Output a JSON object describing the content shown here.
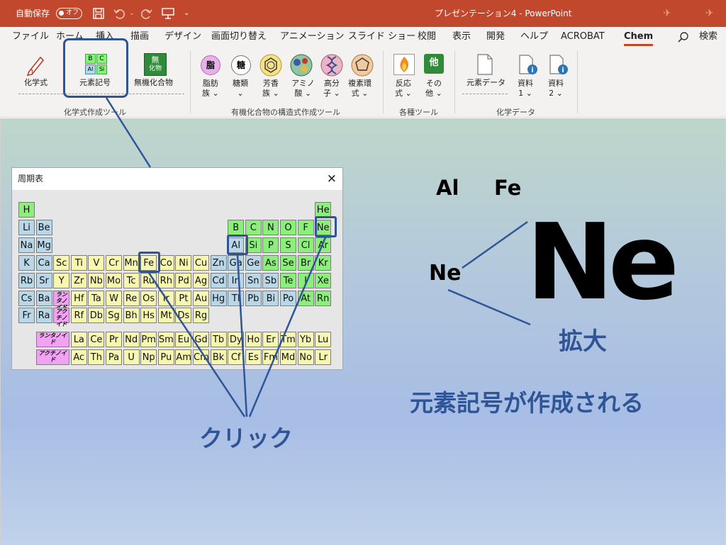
{
  "titlebar": {
    "autosave": "自動保存",
    "toggle": "オフ",
    "title": "プレゼンテーション4  -  PowerPoint"
  },
  "tabs": [
    {
      "label": "ファイル"
    },
    {
      "label": "ホーム"
    },
    {
      "label": "挿入"
    },
    {
      "label": "描画"
    },
    {
      "label": "デザイン"
    },
    {
      "label": "画面切り替え"
    },
    {
      "label": "アニメーション"
    },
    {
      "label": "スライド ショー"
    },
    {
      "label": "校閲"
    },
    {
      "label": "表示"
    },
    {
      "label": "開発"
    },
    {
      "label": "ヘルプ"
    },
    {
      "label": "ACROBAT"
    },
    {
      "label": "Chem"
    }
  ],
  "search_label": "検索",
  "ribbon": {
    "formula": "化学式",
    "element_symbol": "元素記号",
    "inorganic": "無機化合物",
    "inorganic_icon1": "無",
    "inorganic_icon2": "化物",
    "group1": "化学式作成ツール",
    "fatty1": "脂肪",
    "fatty2": "族",
    "sugar": "糖類",
    "aromatic1": "芳香",
    "aromatic2": "族",
    "amino1": "アミノ",
    "amino2": "酸",
    "polymer1": "高分",
    "polymer2": "子",
    "hetero1": "複素環",
    "hetero2": "式",
    "group2": "有機化合物の構造式作成ツール",
    "reaction1": "反応",
    "reaction2": "式",
    "other1": "その",
    "other2": "他",
    "group3": "各種ツール",
    "elemdata": "元素データ",
    "doc1a": "資料",
    "doc1b": "1",
    "doc2a": "資料",
    "doc2b": "2",
    "group4": "化学データ",
    "icon_fat": "脂",
    "icon_sugar": "糖",
    "icon_other": "他",
    "icon_elem_b": "B",
    "icon_elem_c": "C",
    "icon_elem_al": "Al",
    "icon_elem_si": "Si"
  },
  "dialog": {
    "title": "周期表",
    "close": "×"
  },
  "periodic_table": [
    {
      "s": "H",
      "c": "g",
      "r": 0,
      "col": 0
    },
    {
      "s": "He",
      "c": "g",
      "r": 0,
      "col": 17
    },
    {
      "s": "Li",
      "c": "b",
      "r": 1,
      "col": 0
    },
    {
      "s": "Be",
      "c": "b",
      "r": 1,
      "col": 1
    },
    {
      "s": "B",
      "c": "g",
      "r": 1,
      "col": 12
    },
    {
      "s": "C",
      "c": "g",
      "r": 1,
      "col": 13
    },
    {
      "s": "N",
      "c": "g",
      "r": 1,
      "col": 14
    },
    {
      "s": "O",
      "c": "g",
      "r": 1,
      "col": 15
    },
    {
      "s": "F",
      "c": "g",
      "r": 1,
      "col": 16
    },
    {
      "s": "Ne",
      "c": "g",
      "r": 1,
      "col": 17
    },
    {
      "s": "Na",
      "c": "b",
      "r": 2,
      "col": 0
    },
    {
      "s": "Mg",
      "c": "b",
      "r": 2,
      "col": 1
    },
    {
      "s": "Al",
      "c": "b",
      "r": 2,
      "col": 12
    },
    {
      "s": "Si",
      "c": "g",
      "r": 2,
      "col": 13
    },
    {
      "s": "P",
      "c": "g",
      "r": 2,
      "col": 14
    },
    {
      "s": "S",
      "c": "g",
      "r": 2,
      "col": 15
    },
    {
      "s": "Cl",
      "c": "g",
      "r": 2,
      "col": 16
    },
    {
      "s": "Ar",
      "c": "g",
      "r": 2,
      "col": 17
    },
    {
      "s": "K",
      "c": "b",
      "r": 3,
      "col": 0
    },
    {
      "s": "Ca",
      "c": "b",
      "r": 3,
      "col": 1
    },
    {
      "s": "Sc",
      "c": "y",
      "r": 3,
      "col": 2
    },
    {
      "s": "Ti",
      "c": "y",
      "r": 3,
      "col": 3
    },
    {
      "s": "V",
      "c": "y",
      "r": 3,
      "col": 4
    },
    {
      "s": "Cr",
      "c": "y",
      "r": 3,
      "col": 5
    },
    {
      "s": "Mn",
      "c": "y",
      "r": 3,
      "col": 6
    },
    {
      "s": "Fe",
      "c": "y",
      "r": 3,
      "col": 7
    },
    {
      "s": "Co",
      "c": "y",
      "r": 3,
      "col": 8
    },
    {
      "s": "Ni",
      "c": "y",
      "r": 3,
      "col": 9
    },
    {
      "s": "Cu",
      "c": "y",
      "r": 3,
      "col": 10
    },
    {
      "s": "Zn",
      "c": "b",
      "r": 3,
      "col": 11
    },
    {
      "s": "Ga",
      "c": "b",
      "r": 3,
      "col": 12
    },
    {
      "s": "Ge",
      "c": "b",
      "r": 3,
      "col": 13
    },
    {
      "s": "As",
      "c": "g",
      "r": 3,
      "col": 14
    },
    {
      "s": "Se",
      "c": "g",
      "r": 3,
      "col": 15
    },
    {
      "s": "Br",
      "c": "g",
      "r": 3,
      "col": 16
    },
    {
      "s": "Kr",
      "c": "g",
      "r": 3,
      "col": 17
    },
    {
      "s": "Rb",
      "c": "b",
      "r": 4,
      "col": 0
    },
    {
      "s": "Sr",
      "c": "b",
      "r": 4,
      "col": 1
    },
    {
      "s": "Y",
      "c": "y",
      "r": 4,
      "col": 2
    },
    {
      "s": "Zr",
      "c": "y",
      "r": 4,
      "col": 3
    },
    {
      "s": "Nb",
      "c": "y",
      "r": 4,
      "col": 4
    },
    {
      "s": "Mo",
      "c": "y",
      "r": 4,
      "col": 5
    },
    {
      "s": "Tc",
      "c": "y",
      "r": 4,
      "col": 6
    },
    {
      "s": "Ru",
      "c": "y",
      "r": 4,
      "col": 7
    },
    {
      "s": "Rh",
      "c": "y",
      "r": 4,
      "col": 8
    },
    {
      "s": "Pd",
      "c": "y",
      "r": 4,
      "col": 9
    },
    {
      "s": "Ag",
      "c": "y",
      "r": 4,
      "col": 10
    },
    {
      "s": "Cd",
      "c": "b",
      "r": 4,
      "col": 11
    },
    {
      "s": "In",
      "c": "b",
      "r": 4,
      "col": 12
    },
    {
      "s": "Sn",
      "c": "b",
      "r": 4,
      "col": 13
    },
    {
      "s": "Sb",
      "c": "b",
      "r": 4,
      "col": 14
    },
    {
      "s": "Te",
      "c": "g",
      "r": 4,
      "col": 15
    },
    {
      "s": "I",
      "c": "g",
      "r": 4,
      "col": 16
    },
    {
      "s": "Xe",
      "c": "g",
      "r": 4,
      "col": 17
    },
    {
      "s": "Cs",
      "c": "b",
      "r": 5,
      "col": 0
    },
    {
      "s": "Ba",
      "c": "b",
      "r": 5,
      "col": 1
    },
    {
      "s": "ランタノイド",
      "c": "p",
      "r": 5,
      "col": 2
    },
    {
      "s": "Hf",
      "c": "y",
      "r": 5,
      "col": 3
    },
    {
      "s": "Ta",
      "c": "y",
      "r": 5,
      "col": 4
    },
    {
      "s": "W",
      "c": "y",
      "r": 5,
      "col": 5
    },
    {
      "s": "Re",
      "c": "y",
      "r": 5,
      "col": 6
    },
    {
      "s": "Os",
      "c": "y",
      "r": 5,
      "col": 7
    },
    {
      "s": "Ir",
      "c": "y",
      "r": 5,
      "col": 8
    },
    {
      "s": "Pt",
      "c": "y",
      "r": 5,
      "col": 9
    },
    {
      "s": "Au",
      "c": "y",
      "r": 5,
      "col": 10
    },
    {
      "s": "Hg",
      "c": "b",
      "r": 5,
      "col": 11
    },
    {
      "s": "Tl",
      "c": "b",
      "r": 5,
      "col": 12
    },
    {
      "s": "Pb",
      "c": "b",
      "r": 5,
      "col": 13
    },
    {
      "s": "Bi",
      "c": "b",
      "r": 5,
      "col": 14
    },
    {
      "s": "Po",
      "c": "b",
      "r": 5,
      "col": 15
    },
    {
      "s": "At",
      "c": "g",
      "r": 5,
      "col": 16
    },
    {
      "s": "Rn",
      "c": "g",
      "r": 5,
      "col": 17
    },
    {
      "s": "Fr",
      "c": "b",
      "r": 6,
      "col": 0
    },
    {
      "s": "Ra",
      "c": "b",
      "r": 6,
      "col": 1
    },
    {
      "s": "アクチノイド",
      "c": "p",
      "r": 6,
      "col": 2
    },
    {
      "s": "Rf",
      "c": "y",
      "r": 6,
      "col": 3
    },
    {
      "s": "Db",
      "c": "y",
      "r": 6,
      "col": 4
    },
    {
      "s": "Sg",
      "c": "y",
      "r": 6,
      "col": 5
    },
    {
      "s": "Bh",
      "c": "y",
      "r": 6,
      "col": 6
    },
    {
      "s": "Hs",
      "c": "y",
      "r": 6,
      "col": 7
    },
    {
      "s": "Mt",
      "c": "y",
      "r": 6,
      "col": 8
    },
    {
      "s": "Ds",
      "c": "y",
      "r": 6,
      "col": 9
    },
    {
      "s": "Rg",
      "c": "y",
      "r": 6,
      "col": 10
    }
  ],
  "series_rows": [
    {
      "label": "ランタノイド",
      "items": [
        "La",
        "Ce",
        "Pr",
        "Nd",
        "Pm",
        "Sm",
        "Eu",
        "Gd",
        "Tb",
        "Dy",
        "Ho",
        "Er",
        "Tm",
        "Yb",
        "Lu"
      ]
    },
    {
      "label": "アクチノイド",
      "items": [
        "Ac",
        "Th",
        "Pa",
        "U",
        "Np",
        "Pu",
        "Am",
        "Cm",
        "Bk",
        "Cf",
        "Es",
        "Fm",
        "Md",
        "No",
        "Lr"
      ]
    }
  ],
  "slide": {
    "al": "Al",
    "fe": "Fe",
    "ne_small": "Ne",
    "ne_big": "Ne",
    "zoom": "拡大",
    "created": "元素記号が作成される",
    "click": "クリック"
  },
  "colors": {
    "accent": "#c1482c",
    "callout": "#2f5597",
    "nonmetal": "#8bf07a",
    "metal": "#b8d7e8",
    "transition": "#f7f7b0",
    "series": "#f2a2f2"
  }
}
